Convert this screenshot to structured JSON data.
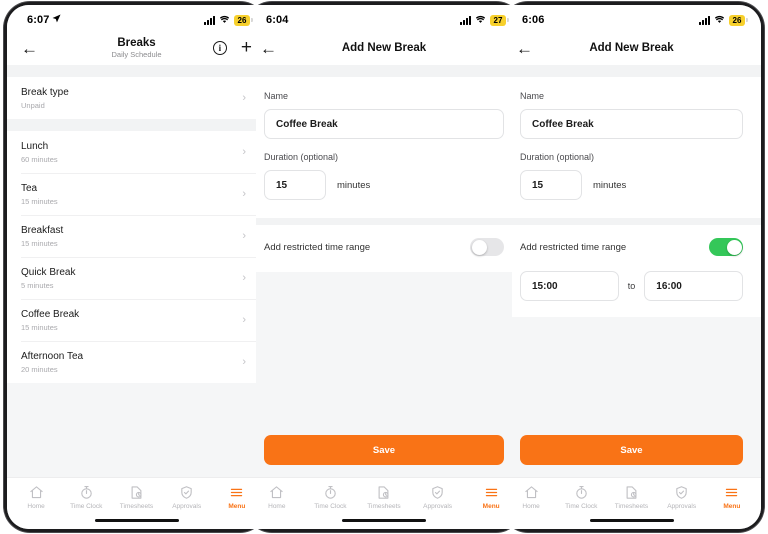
{
  "screens": [
    {
      "id": "breaks-list",
      "status": {
        "time": "6:07",
        "location_arrow": "➤",
        "signal": "signal-bars",
        "wifi": "wifi",
        "battery": "26"
      },
      "nav": {
        "back": "←",
        "title": "Breaks",
        "subtitle": "Daily Schedule",
        "info": "i",
        "plus": "+"
      },
      "break_type": {
        "title": "Break type",
        "value": "Unpaid",
        "chevron": "›"
      },
      "breaks": [
        {
          "name": "Lunch",
          "duration": "60 minutes",
          "chevron": "›"
        },
        {
          "name": "Tea",
          "duration": "15 minutes",
          "chevron": "›"
        },
        {
          "name": "Breakfast",
          "duration": "15 minutes",
          "chevron": "›"
        },
        {
          "name": "Quick Break",
          "duration": "5 minutes",
          "chevron": "›"
        },
        {
          "name": "Coffee Break",
          "duration": "15 minutes",
          "chevron": "›"
        },
        {
          "name": "Afternoon Tea",
          "duration": "20 minutes",
          "chevron": "›"
        }
      ]
    },
    {
      "id": "add-break-toggle-off",
      "status": {
        "time": "6:04",
        "signal": "signal-bars",
        "wifi": "wifi",
        "battery": "27"
      },
      "nav": {
        "back": "←",
        "title": "Add New Break"
      },
      "form": {
        "name_label": "Name",
        "name_value": "Coffee Break",
        "duration_label": "Duration (optional)",
        "duration_value": "15",
        "duration_unit": "minutes"
      },
      "restricted": {
        "label": "Add restricted time range",
        "enabled": false
      },
      "save_label": "Save"
    },
    {
      "id": "add-break-toggle-on",
      "status": {
        "time": "6:06",
        "signal": "signal-bars",
        "wifi": "wifi",
        "battery": "26"
      },
      "nav": {
        "back": "←",
        "title": "Add New Break"
      },
      "form": {
        "name_label": "Name",
        "name_value": "Coffee Break",
        "duration_label": "Duration (optional)",
        "duration_value": "15",
        "duration_unit": "minutes"
      },
      "restricted": {
        "label": "Add restricted time range",
        "enabled": true,
        "start_time": "15:00",
        "separator": "to",
        "end_time": "16:00"
      },
      "save_label": "Save"
    }
  ],
  "tabbar": {
    "items": [
      {
        "label": "Home",
        "icon": "home-icon",
        "active": false
      },
      {
        "label": "Time Clock",
        "icon": "stopwatch-icon",
        "active": false
      },
      {
        "label": "Timesheets",
        "icon": "document-clock-icon",
        "active": false
      },
      {
        "label": "Approvals",
        "icon": "shield-check-icon",
        "active": false
      },
      {
        "label": "Menu",
        "icon": "hamburger-icon",
        "active": true
      }
    ]
  },
  "colors": {
    "accent": "#f97316",
    "toggle_on": "#34c759",
    "battery_badge": "#f7d02c",
    "screen_bg": "#f5f6f7"
  }
}
